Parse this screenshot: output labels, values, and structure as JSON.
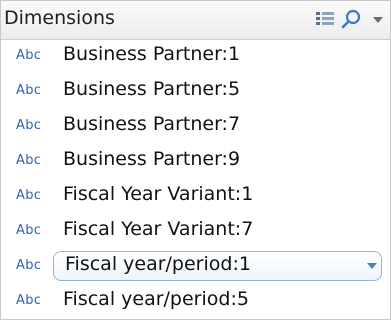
{
  "panel": {
    "title": "Dimensions",
    "icons": [
      "list-view-icon",
      "search-icon",
      "dropdown-arrow-icon"
    ]
  },
  "dimensions": [
    {
      "type": "Abc",
      "label": "Business Partner:1"
    },
    {
      "type": "Abc",
      "label": "Business Partner:5"
    },
    {
      "type": "Abc",
      "label": "Business Partner:7"
    },
    {
      "type": "Abc",
      "label": "Business Partner:9"
    },
    {
      "type": "Abc",
      "label": "Fiscal Year Variant:1"
    },
    {
      "type": "Abc",
      "label": "Fiscal Year Variant:7"
    },
    {
      "type": "Abc",
      "label": "Fiscal year/period:1",
      "selected": true
    },
    {
      "type": "Abc",
      "label": "Fiscal year/period:5"
    }
  ],
  "colors": {
    "type_label": "#2e62b4",
    "selection_border": "#8fb6db",
    "chevron": "#4a7fc4"
  }
}
